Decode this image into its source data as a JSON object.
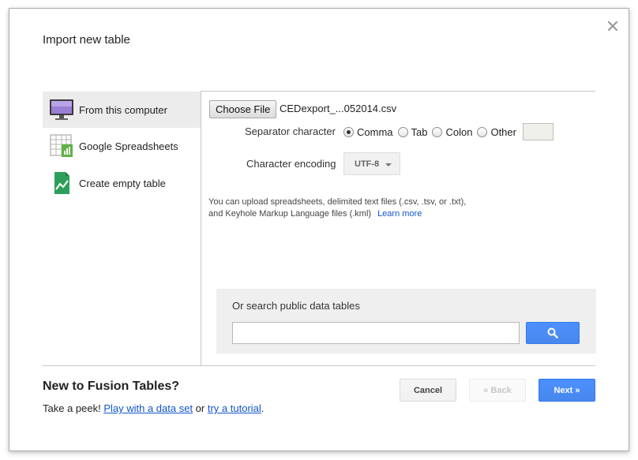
{
  "dialog": {
    "title": "Import new table"
  },
  "sources": [
    {
      "label": "From this computer",
      "icon": "monitor-icon",
      "selected": true
    },
    {
      "label": "Google Spreadsheets",
      "icon": "spreadsheet-icon",
      "selected": false
    },
    {
      "label": "Create empty table",
      "icon": "chart-sheet-icon",
      "selected": false
    }
  ],
  "upload": {
    "choose_label": "Choose File",
    "file_name": "CEDexport_...052014.csv",
    "separator_label": "Separator character",
    "separators": [
      {
        "label": "Comma",
        "checked": true
      },
      {
        "label": "Tab",
        "checked": false
      },
      {
        "label": "Colon",
        "checked": false
      },
      {
        "label": "Other",
        "checked": false
      }
    ],
    "other_value": "",
    "encoding_label": "Character encoding",
    "encoding_value": "UTF-8",
    "help_line1": "You can upload spreadsheets, delimited text files (.csv, .tsv, or .txt),",
    "help_line2": "and Keyhole Markup Language files (.kml)",
    "learn_more": "Learn more"
  },
  "search": {
    "label": "Or search public data tables",
    "value": "",
    "button_icon": "search-icon"
  },
  "promo": {
    "title": "New to Fusion Tables?",
    "prefix": "Take a peek! ",
    "link1": "Play with a data set",
    "middle": " or ",
    "link2": "try a tutorial",
    "suffix": "."
  },
  "buttons": {
    "cancel": "Cancel",
    "back": "« Back",
    "next": "Next »"
  },
  "colors": {
    "primary_blue": "#4d90fe",
    "link": "#1155cc",
    "selected_bg": "#ececec"
  }
}
